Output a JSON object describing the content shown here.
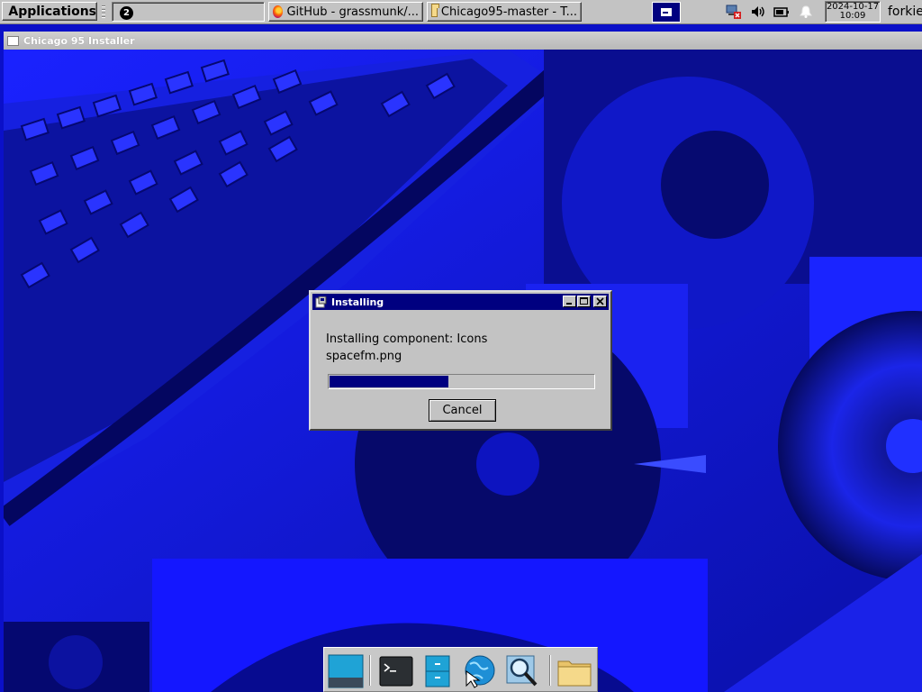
{
  "top_panel": {
    "applications_label": "Applications",
    "workspace_number": "2",
    "tasks": [
      {
        "label": "GitHub - grassmunk/...",
        "icon": "firefox-icon"
      },
      {
        "label": "Chicago95-master - T...",
        "icon": "folder-icon"
      }
    ],
    "clock": {
      "date": "2024-10-17",
      "time": "10:09"
    },
    "user": "forkie",
    "tray_icons": [
      "network-disconnected-icon",
      "volume-icon",
      "battery-icon",
      "notification-bell-icon"
    ]
  },
  "installer_window": {
    "title": "Chicago 95 Installer"
  },
  "dialog": {
    "title": "Installing",
    "message_line1": "Installing component: Icons",
    "message_line2": "spacefm.png",
    "progress_fraction": 0.45,
    "cancel_label": "Cancel",
    "title_buttons": [
      "minimize-icon",
      "maximize-icon",
      "close-icon"
    ]
  },
  "dock": {
    "items": [
      "show-desktop-icon",
      "terminal-icon",
      "file-manager-drawer-icon",
      "web-browser-icon",
      "app-finder-icon",
      "home-folder-icon"
    ]
  },
  "colors": {
    "panel": "#c3c3c3",
    "titlebar_active": "#000080",
    "wallpaper_blue": "#0a0fd4",
    "progress_fill": "#000080"
  }
}
